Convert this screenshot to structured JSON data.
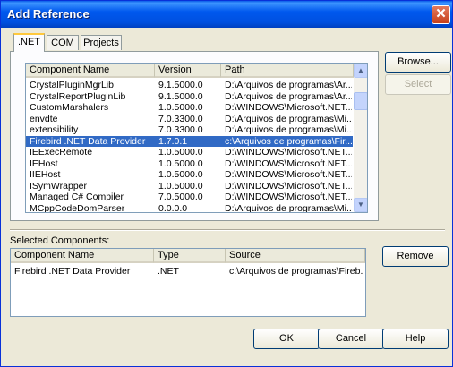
{
  "window": {
    "title": "Add Reference",
    "close_glyph": "✕"
  },
  "tabs": [
    {
      "label": ".NET",
      "active": true
    },
    {
      "label": "COM",
      "active": false
    },
    {
      "label": "Projects",
      "active": false
    }
  ],
  "components_list": {
    "columns": [
      "Component Name",
      "Version",
      "Path"
    ],
    "rows": [
      [
        "CrystalPluginMgrLib",
        "9.1.5000.0",
        "D:\\Arquivos de programas\\Ar..."
      ],
      [
        "CrystalReportPluginLib",
        "9.1.5000.0",
        "D:\\Arquivos de programas\\Ar..."
      ],
      [
        "CustomMarshalers",
        "1.0.5000.0",
        "D:\\WINDOWS\\Microsoft.NET..."
      ],
      [
        "envdte",
        "7.0.3300.0",
        "D:\\Arquivos de programas\\Mi..."
      ],
      [
        "extensibility",
        "7.0.3300.0",
        "D:\\Arquivos de programas\\Mi..."
      ],
      [
        "Firebird .NET Data Provider",
        "1.7.0.1",
        "c:\\Arquivos de programas\\Fir..."
      ],
      [
        "IEExecRemote",
        "1.0.5000.0",
        "D:\\WINDOWS\\Microsoft.NET..."
      ],
      [
        "IEHost",
        "1.0.5000.0",
        "D:\\WINDOWS\\Microsoft.NET..."
      ],
      [
        "IIEHost",
        "1.0.5000.0",
        "D:\\WINDOWS\\Microsoft.NET..."
      ],
      [
        "ISymWrapper",
        "1.0.5000.0",
        "D:\\WINDOWS\\Microsoft.NET..."
      ],
      [
        "Managed C# Compiler",
        "7.0.5000.0",
        "D:\\WINDOWS\\Microsoft.NET..."
      ],
      [
        "MCppCodeDomParser",
        "0.0.0.0",
        "D:\\Arquivos de programas\\Mi..."
      ]
    ],
    "selected_index": 5
  },
  "buttons": {
    "browse": "Browse...",
    "select": "Select",
    "remove": "Remove",
    "ok": "OK",
    "cancel": "Cancel",
    "help": "Help"
  },
  "selected_components": {
    "label": "Selected Components:",
    "columns": [
      "Component Name",
      "Type",
      "Source"
    ],
    "rows": [
      [
        "Firebird .NET Data Provider",
        ".NET",
        "c:\\Arquivos de programas\\Fireb..."
      ]
    ]
  },
  "colors": {
    "titlebar": "#0058ee",
    "selection": "#316ac5",
    "dialog_bg": "#ece9d8"
  }
}
